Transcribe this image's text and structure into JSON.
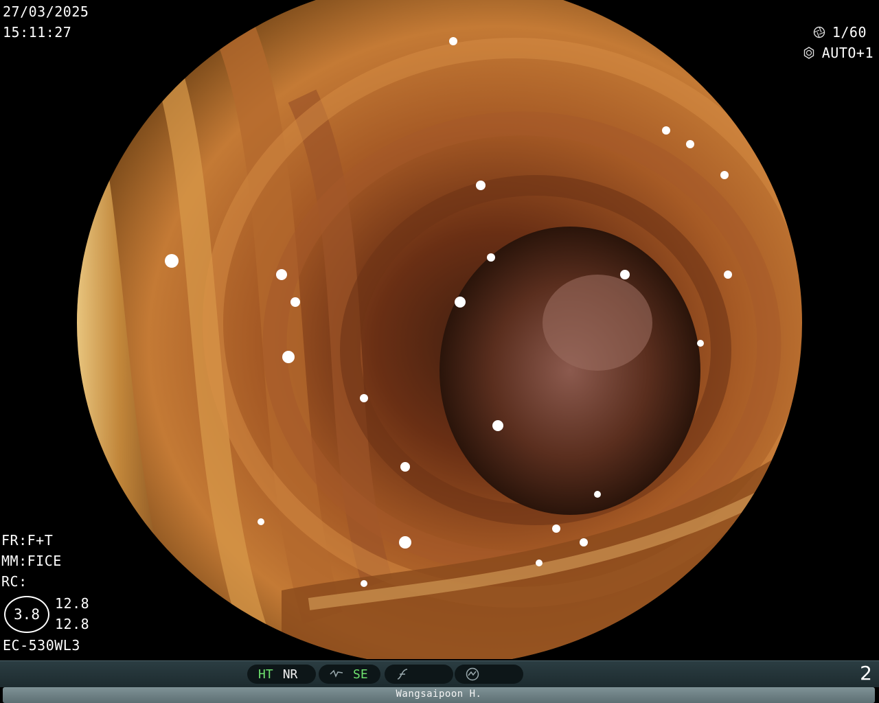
{
  "header": {
    "date": "27/03/2025",
    "time": "15:11:27",
    "shutter": "1/60",
    "exposure": "AUTO+1",
    "shutter_icon": "aperture-icon",
    "exposure_icon": "iris-icon"
  },
  "settings": {
    "fr": "FR:F+T",
    "mm": "MM:FICE",
    "rc": "RC:",
    "zoom": "3.8",
    "value_1": "12.8",
    "value_2": "12.8",
    "scope_model": "EC-530WL3"
  },
  "status_bar": {
    "ht": "HT",
    "nr": "NR",
    "se": "SE",
    "page": "2",
    "icons": [
      "structure-enhance-icon",
      "color-curve-icon",
      "mode-circle-icon"
    ],
    "active_color": "#6fe26f"
  },
  "footer": {
    "operator": "Wangsaipoon H."
  }
}
